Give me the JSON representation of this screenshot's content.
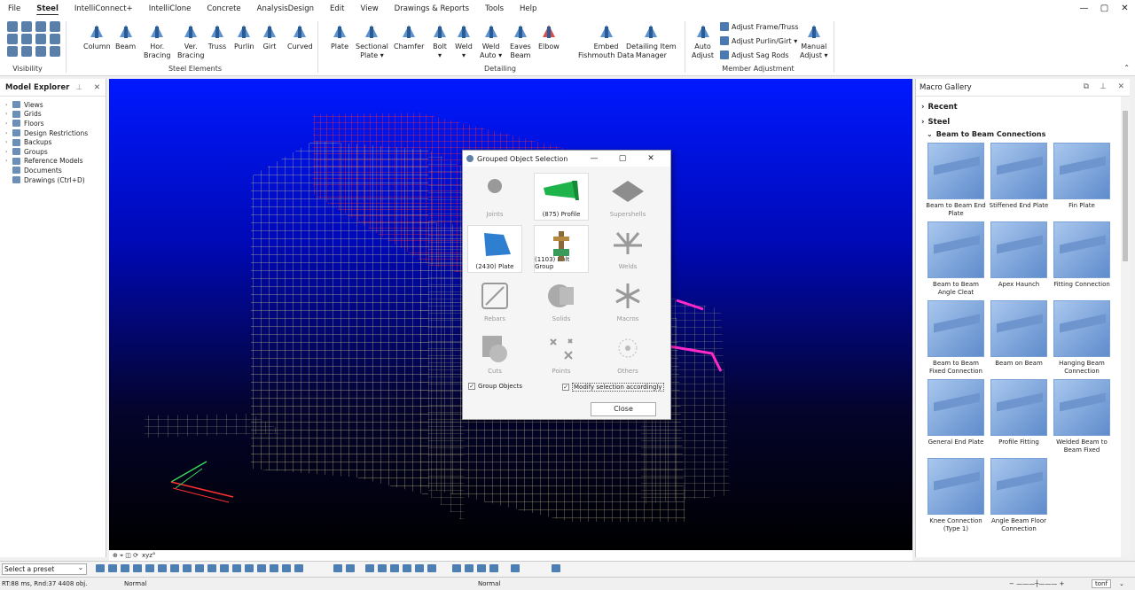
{
  "menu": [
    "File",
    "Steel",
    "IntelliConnect+",
    "IntelliClone",
    "Concrete",
    "AnalysisDesign",
    "Edit",
    "View",
    "Drawings & Reports",
    "Tools",
    "Help"
  ],
  "window_controls": [
    "—",
    "▢",
    "✕"
  ],
  "ribbon": {
    "visibility_label": "Visibility",
    "steel_elements_label": "Steel Elements",
    "detailing_label": "Detailing",
    "member_adjustment_label": "Member Adjustment",
    "steel_buttons": [
      {
        "label": "Column"
      },
      {
        "label": "Beam"
      },
      {
        "label": "Hor.\nBracing"
      },
      {
        "label": "Ver.\nBracing"
      },
      {
        "label": "Truss"
      },
      {
        "label": "Purlin"
      },
      {
        "label": "Girt"
      },
      {
        "label": "Curved"
      }
    ],
    "detailing_buttons": [
      {
        "label": "Plate"
      },
      {
        "label": "Sectional\nPlate ▾"
      },
      {
        "label": "Chamfer"
      },
      {
        "label": "Bolt\n▾"
      },
      {
        "label": "Weld\n▾"
      },
      {
        "label": "Weld\nAuto ▾"
      },
      {
        "label": "Eaves\nBeam"
      },
      {
        "label": "Elbow"
      },
      {
        "label": "Embed\nFishmouth Data"
      },
      {
        "label": "Detailing Item\nManager"
      }
    ],
    "member_buttons": [
      {
        "label": "Auto\nAdjust"
      },
      {
        "label": "Manual\nAdjust ▾"
      }
    ],
    "member_small": [
      "Adjust Frame/Truss",
      "Adjust Purlin/Girt ▾",
      "Adjust Sag Rods"
    ]
  },
  "explorer": {
    "title": "Model Explorer",
    "items": [
      "Views",
      "Grids",
      "Floors",
      "Design Restrictions",
      "Backups",
      "Groups",
      "Reference Models",
      "Documents",
      "Drawings (Ctrl+D)"
    ]
  },
  "dialog": {
    "title": "Grouped Object Selection",
    "tiles": [
      {
        "label": "Joints",
        "enabled": false
      },
      {
        "label": "(875) Profile",
        "enabled": true
      },
      {
        "label": "Supershells",
        "enabled": false
      },
      {
        "label": "(2430) Plate",
        "enabled": true
      },
      {
        "label": "(1103) Bolt Group",
        "enabled": true
      },
      {
        "label": "Welds",
        "enabled": false
      },
      {
        "label": "Rebars",
        "enabled": false
      },
      {
        "label": "Solids",
        "enabled": false
      },
      {
        "label": "Macros",
        "enabled": false
      },
      {
        "label": "Cuts",
        "enabled": false
      },
      {
        "label": "Points",
        "enabled": false
      },
      {
        "label": "Others",
        "enabled": false
      }
    ],
    "group_objects": "Group Objects",
    "modify_selection": "Modify selection accordingly",
    "close": "Close"
  },
  "gallery": {
    "title": "Macro Gallery",
    "recent": "Recent",
    "steel": "Steel",
    "section": "Beam to Beam Connections",
    "items": [
      "Beam to Beam End Plate",
      "Stiffened End Plate",
      "Fin Plate",
      "Beam to Beam Angle Cleat",
      "Apex Haunch",
      "Fitting Connection",
      "Beam to Beam Fixed Connection",
      "Beam on Beam",
      "Hanging Beam Connection",
      "General End Plate",
      "Profile Fitting",
      "Welded Beam to Beam Fixed",
      "Knee Connection (Type 1)",
      "Angle Beam Floor Connection"
    ]
  },
  "viewport_toolbar": "xyz°",
  "preset": "Select a preset",
  "status": {
    "left": "RT:88 ms, Rnd:37  4408 obj.",
    "mode1": "Normal",
    "mode2": "Normal",
    "units": "tonf"
  }
}
